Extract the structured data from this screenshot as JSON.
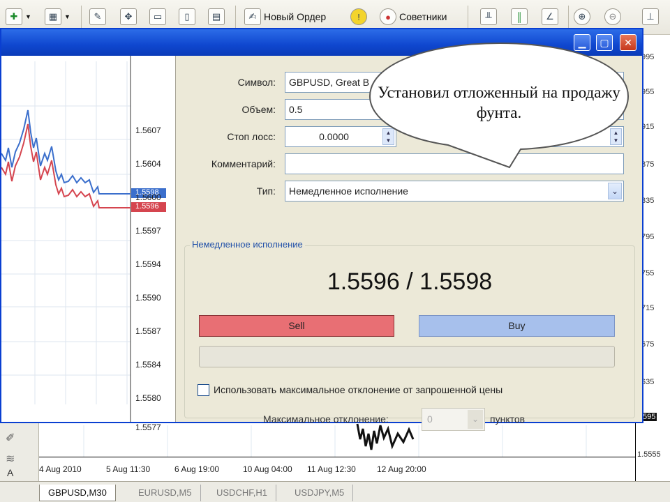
{
  "toolbar": {
    "new_order_label": "Новый Ордер",
    "advisors_label": "Советники"
  },
  "right_axis": {
    "labels": [
      "995",
      "955",
      "915",
      "875",
      "835",
      "795",
      "755",
      "715",
      "675",
      "635",
      "595",
      "1.5555"
    ]
  },
  "bottom_axis": {
    "labels": [
      "4 Aug 2010",
      "5 Aug 11:30",
      "6 Aug 19:00",
      "10 Aug 04:00",
      "11 Aug 12:30",
      "12 Aug 20:00"
    ]
  },
  "tabs": [
    {
      "label": "GBPUSD,M30",
      "active": true
    },
    {
      "label": "EURUSD,M5",
      "active": false
    },
    {
      "label": "USDCHF,H1",
      "active": false
    },
    {
      "label": "USDJPY,M5",
      "active": false
    }
  ],
  "side_letter": "A",
  "mini_chart": {
    "price_labels": [
      "1.5607",
      "1.5604",
      "1.5600",
      "1.5597",
      "1.5594",
      "1.5590",
      "1.5587",
      "1.5584",
      "1.5580",
      "1.5577"
    ],
    "ask_tag": "1.5598",
    "bid_tag": "1.5596",
    "colors": {
      "ask": "#3b6fcc",
      "bid": "#d5454f"
    }
  },
  "order": {
    "symbol_label": "Символ:",
    "symbol_value": "GBPUSD, Great B",
    "volume_label": "Объем:",
    "volume_value": "0.5",
    "stoploss_label": "Стоп лосс:",
    "stoploss_value": "0.0000",
    "comment_label": "Комментарий:",
    "comment_value": "",
    "type_label": "Тип:",
    "type_value": "Немедленное исполнение",
    "group_title": "Немедленное исполнение",
    "prices": "1.5596 / 1.5598",
    "sell_label": "Sell",
    "buy_label": "Buy",
    "deviation_checkbox_label": "Использовать максимальное отклонение от запрошенной цены",
    "max_deviation_label": "Максимальное отклонение:",
    "max_deviation_value": "0",
    "points_label": "пунктов"
  },
  "bubble": {
    "text": "Установил отложенный на продажу фунта."
  }
}
